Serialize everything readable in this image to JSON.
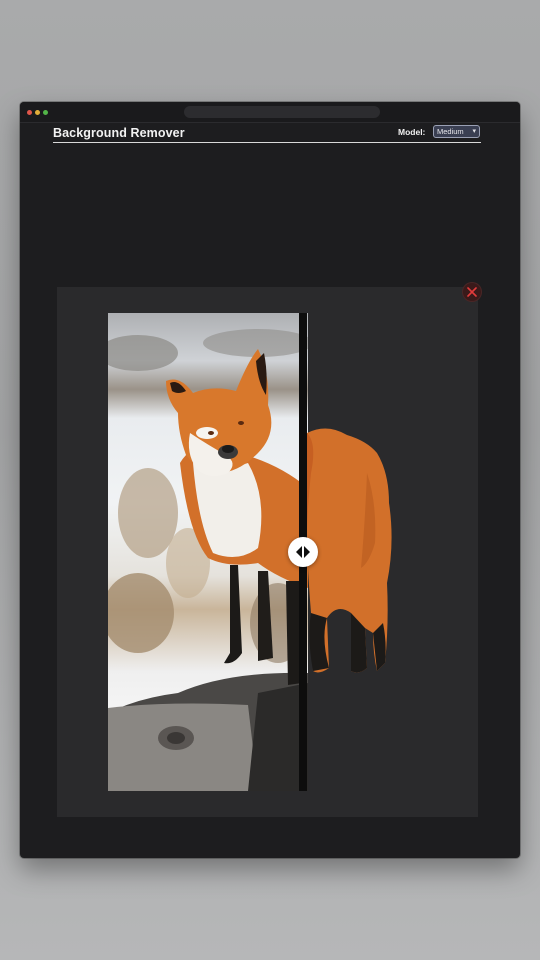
{
  "app": {
    "title": "Background Remover"
  },
  "model": {
    "label": "Model:",
    "selected": "Medium"
  },
  "icons": {
    "close": "close-icon",
    "chevron": "chevron-down-icon",
    "compare_handle": "left-right-arrows-icon"
  },
  "colors": {
    "window_bg": "#1d1d1f",
    "panel_bg": "#2a2a2c",
    "close_icon": "#e23b3b",
    "fox_orange": "#d2702a"
  }
}
